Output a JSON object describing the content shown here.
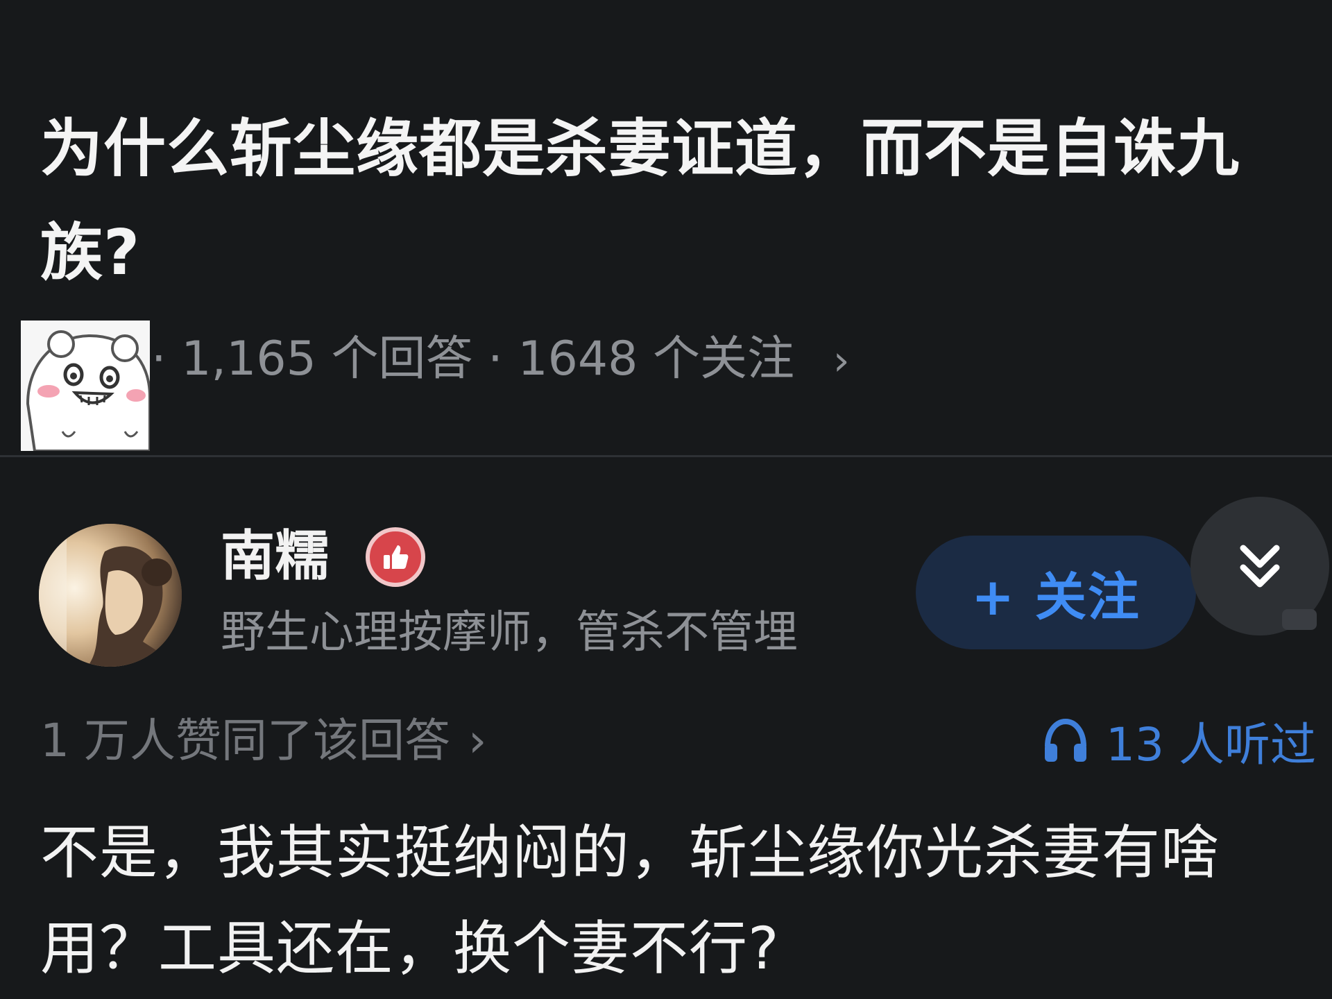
{
  "question": {
    "title": "为什么斩尘缘都是杀妻证道，而不是自诛九族?",
    "answer_count": "· 1,165 个回答",
    "follow_count": "· 1648 个关注",
    "meta_chevron": "›"
  },
  "author": {
    "name": "南糯",
    "bio": "野生心理按摩师，管杀不管埋",
    "follow_label": "+ 关注"
  },
  "stats": {
    "upvotes": "1 万人赞同了该回答",
    "upvotes_chevron": "›",
    "listens": "13 人听过"
  },
  "answer": {
    "body": "不是，我其实挺纳闷的，斩尘缘你光杀妻有啥用？工具还在，换个妻不行?"
  },
  "colors": {
    "background": "#17191b",
    "accent_blue": "#3f8cf4",
    "muted_text": "#8e9196",
    "badge_red": "#d7454b"
  },
  "icons": {
    "sticker": "smiling-bear-sticker",
    "badge": "thumbs-up-badge-icon",
    "expand": "double-chevron-down-icon",
    "listen": "headphones-icon"
  }
}
